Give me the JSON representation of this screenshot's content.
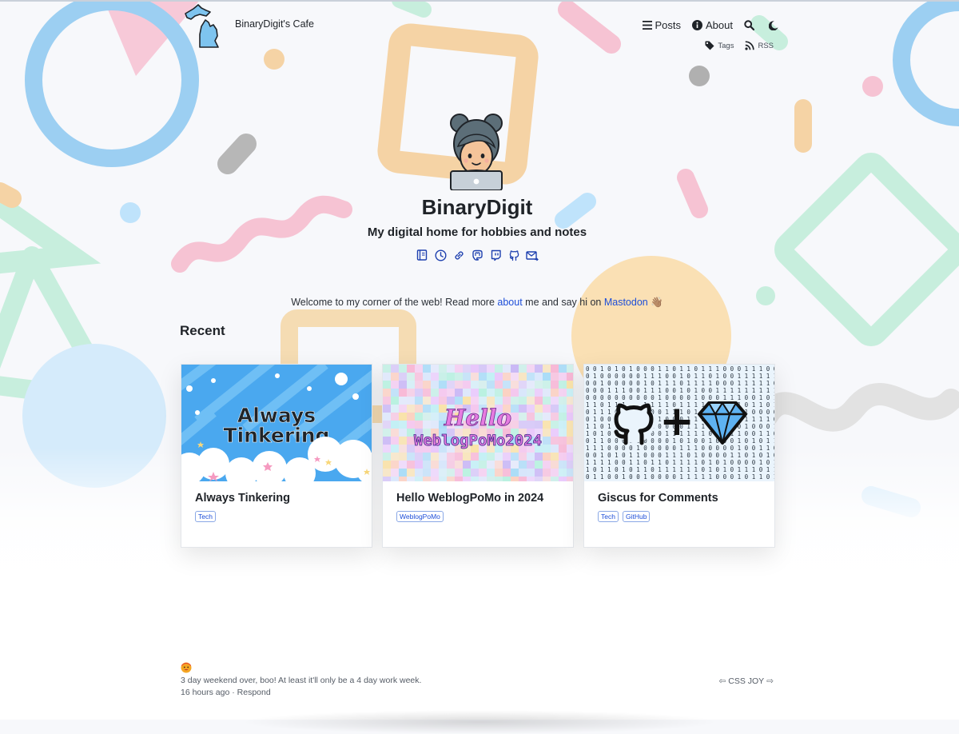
{
  "site": {
    "name": "BinaryDigit's Cafe"
  },
  "nav": {
    "posts": "Posts",
    "about": "About",
    "tags": "Tags",
    "rss": "RSS"
  },
  "hero": {
    "title": "BinaryDigit",
    "subtitle": "My digital home for hobbies and notes"
  },
  "social_icons": [
    "guestbook-icon",
    "now-icon",
    "links-icon",
    "mastodon-icon",
    "twitch-icon",
    "github-icon",
    "email-icon"
  ],
  "welcome": {
    "before": "Welcome to my corner of the web! Read more ",
    "about_link": "about",
    "middle": " me and say hi on ",
    "mastodon_link": "Mastodon",
    "emoji": "👋🏽"
  },
  "recent": {
    "heading": "Recent",
    "cards": [
      {
        "title": "Always Tinkering",
        "thumb_text": [
          "Always",
          "Tinkering"
        ],
        "tags": [
          "Tech"
        ]
      },
      {
        "title": "Hello WeblogPoMo in 2024",
        "thumb_text": [
          "Hello",
          "WeblogPoMo2024"
        ],
        "tags": [
          "WeblogPoMo"
        ]
      },
      {
        "title": "Giscus for Comments",
        "thumb_text": [
          "+"
        ],
        "tags": [
          "Tech",
          "GitHub"
        ]
      }
    ]
  },
  "status": {
    "text": "3 day weekend over, boo! At least it'll only be a 4 day work week.",
    "time": "16 hours ago",
    "separator": " · ",
    "respond": "Respond"
  },
  "webring": {
    "label": "CSS JOY",
    "prev": "⇦",
    "next": "⇨"
  },
  "colors": {
    "accent": "#1d4ed8",
    "text": "#1f2328"
  }
}
